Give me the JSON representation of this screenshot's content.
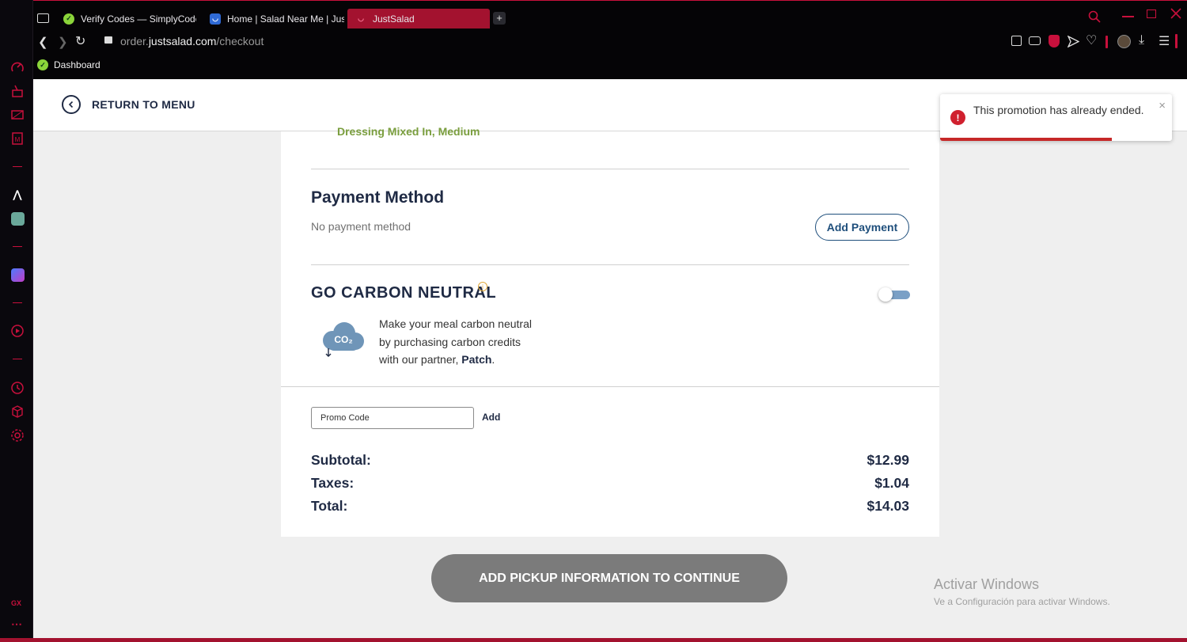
{
  "browser": {
    "tabs": [
      {
        "title": "Verify Codes — SimplyCodes",
        "active": false
      },
      {
        "title": "Home | Salad Near Me | Just Salad",
        "active": false
      },
      {
        "title": "JustSalad",
        "active": true
      }
    ],
    "new_tab_label": "+",
    "url_domain_prefix": "order.",
    "url_domain": "justsalad.com",
    "url_path": "/checkout",
    "bookmark": "Dashboard",
    "sidebar_badge": "GX",
    "accent_color": "#c8103c"
  },
  "header": {
    "return_label": "RETURN TO MENU"
  },
  "cart": {
    "cut_item_text": "Dressing Mixed In, Medium"
  },
  "payment": {
    "title": "Payment Method",
    "none_text": "No payment method",
    "add_label": "Add Payment"
  },
  "carbon": {
    "title": "GO CARBON NEUTRAL",
    "info_symbol": "i",
    "co2_label": "CO₂",
    "desc_line1": "Make your meal carbon neutral",
    "desc_line2": "by purchasing carbon credits",
    "desc_line3_prefix": "with our partner, ",
    "partner": "Patch",
    "desc_line3_suffix": ".",
    "toggle_on": false
  },
  "promo": {
    "placeholder": "Promo Code",
    "add_label": "Add"
  },
  "summary": {
    "subtotal_label": "Subtotal:",
    "subtotal_value": "$12.99",
    "taxes_label": "Taxes:",
    "taxes_value": "$1.04",
    "total_label": "Total:",
    "total_value": "$14.03"
  },
  "continue_label": "ADD PICKUP INFORMATION TO CONTINUE",
  "toast": {
    "message": "This promotion has already ended.",
    "close_symbol": "×",
    "icon_symbol": "!",
    "progress": 0.74
  },
  "watermark": {
    "title": "Activar Windows",
    "subtitle": "Ve a Configuración para activar Windows."
  }
}
